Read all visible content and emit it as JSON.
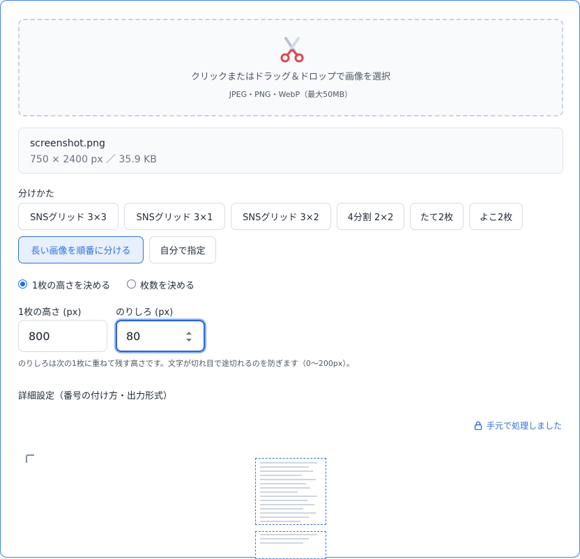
{
  "dropzone": {
    "icon": "scissors-icon",
    "main_text": "クリックまたはドラッグ＆ドロップで画像を選択",
    "sub_text": "JPEG・PNG・WebP（最大50MB）"
  },
  "file": {
    "name": "screenshot.png",
    "meta": "750 × 2400 px ／ 35.9 KB"
  },
  "split_mode": {
    "label": "分けかた",
    "options": [
      {
        "label": "SNSグリッド 3×3",
        "selected": false
      },
      {
        "label": "SNSグリッド 3×1",
        "selected": false
      },
      {
        "label": "SNSグリッド 3×2",
        "selected": false
      },
      {
        "label": "4分割 2×2",
        "selected": false
      },
      {
        "label": "たて2枚",
        "selected": false
      },
      {
        "label": "よこ2枚",
        "selected": false
      },
      {
        "label": "長い画像を順番に分ける",
        "selected": true
      },
      {
        "label": "自分で指定",
        "selected": false
      }
    ]
  },
  "radio": {
    "options": [
      {
        "label": "1枚の高さを決める",
        "checked": true
      },
      {
        "label": "枚数を決める",
        "checked": false
      }
    ]
  },
  "height": {
    "label": "1枚の高さ (px)",
    "value": "800"
  },
  "margin": {
    "label": "のりしろ (px)",
    "value": "80"
  },
  "hint": "のりしろは次の1枚に重ねて残す高さです。文字が切れ目で途切れるのを防ぎます（0〜200px）。",
  "details_label": "詳細設定（番号の付け方・出力形式）",
  "local_processing": {
    "icon": "lock-icon",
    "text": "手元で処理しました"
  },
  "colors": {
    "accent": "#2f6fde",
    "border": "#d5dbe3",
    "focus": "#2563eb"
  }
}
